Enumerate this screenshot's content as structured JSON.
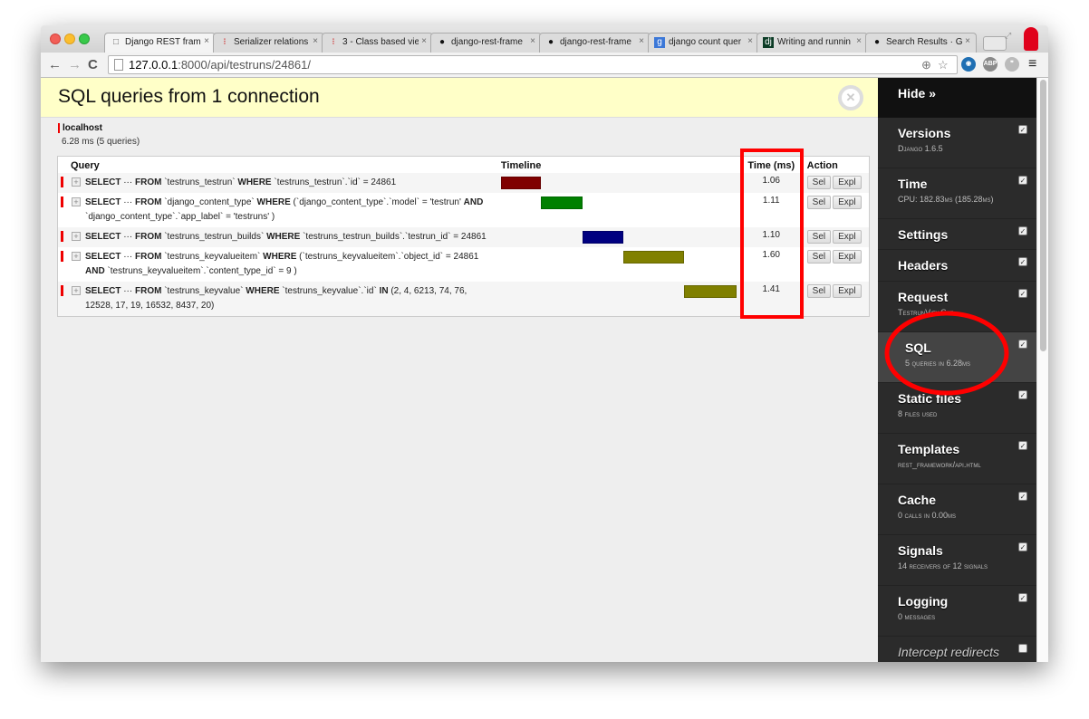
{
  "browser": {
    "tabs": [
      {
        "label": "Django REST frame",
        "icon": "page-icon",
        "active": true
      },
      {
        "label": "Serializer relations",
        "icon": "drf-icon"
      },
      {
        "label": "3 - Class based vie",
        "icon": "drf-icon"
      },
      {
        "label": "django-rest-frame",
        "icon": "github-icon"
      },
      {
        "label": "django-rest-frame",
        "icon": "github-icon"
      },
      {
        "label": "django count quer",
        "icon": "google-icon"
      },
      {
        "label": "Writing and runnin",
        "icon": "django-icon"
      },
      {
        "label": "Search Results · Gi",
        "icon": "github-icon"
      }
    ],
    "url_host": "127.0.0.1",
    "url_path": ":8000/api/testruns/24861/",
    "ext_labels": {
      "abp": "ABP"
    }
  },
  "panel": {
    "title": "SQL queries from 1 connection",
    "connection": {
      "host": "localhost",
      "stats": "6.28 ms (5 queries)"
    },
    "columns": {
      "query": "Query",
      "timeline": "Timeline",
      "time": "Time (ms)",
      "action": "Action"
    },
    "action_labels": {
      "sel": "Sel",
      "expl": "Expl"
    },
    "queries": [
      {
        "parts": [
          [
            "b",
            "SELECT"
          ],
          [
            "t",
            " ··· "
          ],
          [
            "b",
            "FROM"
          ],
          [
            "t",
            " `testruns_testrun` "
          ],
          [
            "b",
            "WHERE"
          ],
          [
            "t",
            " `testruns_testrun`.`id` = 24861"
          ]
        ],
        "time": "1.06",
        "start_pct": 0,
        "width_pct": 16.9,
        "color": "#800000"
      },
      {
        "parts": [
          [
            "b",
            "SELECT"
          ],
          [
            "t",
            " ··· "
          ],
          [
            "b",
            "FROM"
          ],
          [
            "t",
            " `django_content_type` "
          ],
          [
            "b",
            "WHERE"
          ],
          [
            "t",
            " (`django_content_type`.`model` = 'testrun' "
          ],
          [
            "b",
            "AND"
          ],
          [
            "t",
            " `django_content_type`.`app_label` = 'testruns' )"
          ]
        ],
        "time": "1.11",
        "start_pct": 16.9,
        "width_pct": 17.7,
        "color": "#008000"
      },
      {
        "parts": [
          [
            "b",
            "SELECT"
          ],
          [
            "t",
            " ··· "
          ],
          [
            "b",
            "FROM"
          ],
          [
            "t",
            " `testruns_testrun_builds` "
          ],
          [
            "b",
            "WHERE"
          ],
          [
            "t",
            " `testruns_testrun_builds`.`testrun_id` = 24861"
          ]
        ],
        "time": "1.10",
        "start_pct": 34.6,
        "width_pct": 17.5,
        "color": "#000080"
      },
      {
        "parts": [
          [
            "b",
            "SELECT"
          ],
          [
            "t",
            " ··· "
          ],
          [
            "b",
            "FROM"
          ],
          [
            "t",
            " `testruns_keyvalueitem` "
          ],
          [
            "b",
            "WHERE"
          ],
          [
            "t",
            " (`testruns_keyvalueitem`.`object_id` = 24861 "
          ],
          [
            "b",
            "AND"
          ],
          [
            "t",
            " `testruns_keyvalueitem`.`content_type_id` = 9 )"
          ]
        ],
        "time": "1.60",
        "start_pct": 52.1,
        "width_pct": 25.5,
        "color": "#808000"
      },
      {
        "parts": [
          [
            "b",
            "SELECT"
          ],
          [
            "t",
            " ··· "
          ],
          [
            "b",
            "FROM"
          ],
          [
            "t",
            " `testruns_keyvalue` "
          ],
          [
            "b",
            "WHERE"
          ],
          [
            "t",
            " `testruns_keyvalue`.`id` "
          ],
          [
            "b",
            "IN"
          ],
          [
            "t",
            " (2, 4, 6213, 74, 76, 12528, 17, 19, 16532, 8437, 20)"
          ]
        ],
        "time": "1.41",
        "start_pct": 77.6,
        "width_pct": 22.4,
        "color": "#808000"
      }
    ]
  },
  "toolbar": {
    "hide_label": "Hide »",
    "items": [
      {
        "title": "Versions",
        "subtitle": "Django 1.6.5",
        "checked": true
      },
      {
        "title": "Time",
        "subtitle": "CPU: 182.83ms (185.28ms)",
        "checked": true
      },
      {
        "title": "Settings",
        "subtitle": "",
        "checked": true
      },
      {
        "title": "Headers",
        "subtitle": "",
        "checked": true
      },
      {
        "title": "Request",
        "subtitle": "TestrunViewSet",
        "checked": true
      },
      {
        "title": "SQL",
        "subtitle": "5 queries in 6.28ms",
        "checked": true,
        "active": true
      },
      {
        "title": "Static files",
        "subtitle": "8 files used",
        "checked": true
      },
      {
        "title": "Templates",
        "subtitle": "rest_framework/api.html",
        "checked": true
      },
      {
        "title": "Cache",
        "subtitle": "0 calls in 0.00ms",
        "checked": true
      },
      {
        "title": "Signals",
        "subtitle": "14 receivers of 12 signals",
        "checked": true
      },
      {
        "title": "Logging",
        "subtitle": "0 messages",
        "checked": true
      },
      {
        "title": "Intercept redirects",
        "subtitle": "",
        "checked": false,
        "italic": true
      }
    ]
  },
  "colors": {
    "highlight": "#ff0000",
    "panel_header": "#ffffc8",
    "toolbar_bg": "#2b2b2b"
  }
}
